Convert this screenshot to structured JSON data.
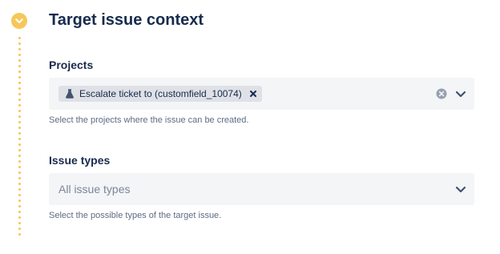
{
  "section": {
    "title": "Target issue context",
    "step_icon": "chevron-down-icon",
    "accent_color": "#f5c75b"
  },
  "projects": {
    "label": "Projects",
    "selected": [
      {
        "label": "Escalate ticket to (customfield_10074)",
        "icon": "flask-icon",
        "remove_icon": "close-icon"
      }
    ],
    "clear_icon": "clear-circle-icon",
    "dropdown_icon": "chevron-down-icon",
    "help": "Select the projects where the issue can be created."
  },
  "issue_types": {
    "label": "Issue types",
    "placeholder": "All issue types",
    "dropdown_icon": "chevron-down-icon",
    "help": "Select the possible types of the target issue."
  }
}
